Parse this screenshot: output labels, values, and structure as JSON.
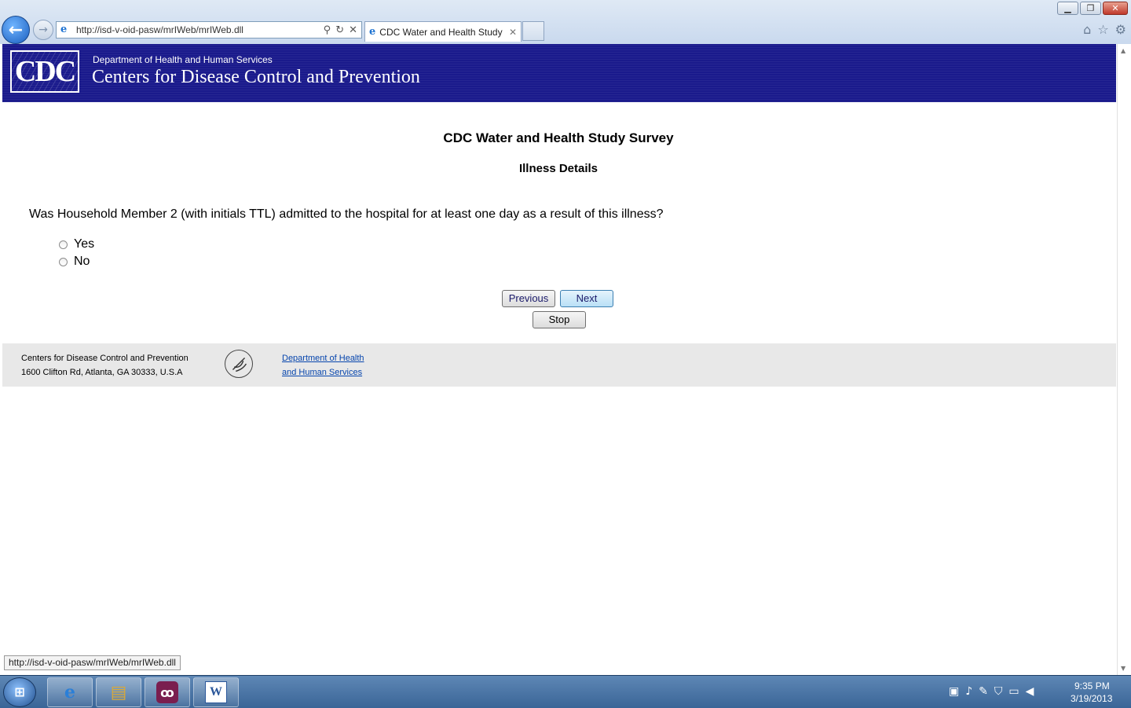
{
  "browser": {
    "address_url": "http://isd-v-oid-pasw/mrIWeb/mrIWeb.dll",
    "tab_title": "CDC Water and Health Study",
    "status_url": "http://isd-v-oid-pasw/mrIWeb/mrIWeb.dll"
  },
  "banner": {
    "logo_text": "CDC",
    "department": "Department of Health and Human Services",
    "agency": "Centers for Disease Control and Prevention"
  },
  "survey": {
    "title": "CDC Water and Health Study Survey",
    "section": "Illness Details",
    "question": "Was Household Member 2 (with initials TTL) admitted to the hospital for at least one day as a result of this illness?",
    "options": [
      {
        "label": "Yes",
        "selected": false
      },
      {
        "label": "No",
        "selected": false
      }
    ],
    "buttons": {
      "previous": "Previous",
      "next": "Next",
      "stop": "Stop"
    }
  },
  "footer": {
    "org_name": "Centers for Disease Control and Prevention",
    "address": "1600 Clifton Rd, Atlanta, GA 30333, U.S.A",
    "hhs_link_line1": "Department of Health",
    "hhs_link_line2": "and Human Services"
  },
  "taskbar": {
    "time": "9:35 PM",
    "date": "3/19/2013",
    "word_icon_letter": "W"
  },
  "colors": {
    "banner": "#1a1a8c",
    "footer_bg": "#e8e8e8",
    "link": "#0645ad"
  }
}
